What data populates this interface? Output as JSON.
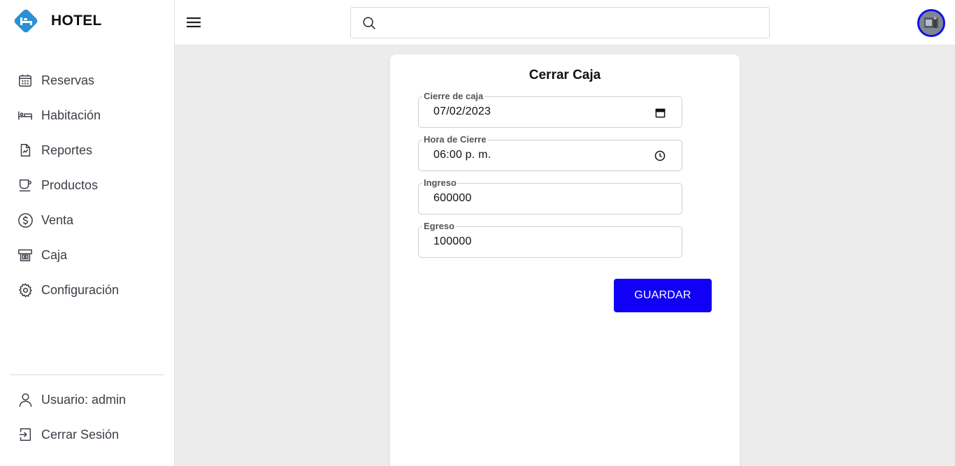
{
  "brand": {
    "title": "HOTEL",
    "logo_icon": "hotel-bed-logo",
    "logo_color": "#2a8fd6"
  },
  "sidebar": {
    "items": [
      {
        "label": "Reservas",
        "icon": "calendar-icon"
      },
      {
        "label": "Habitación",
        "icon": "bed-icon"
      },
      {
        "label": "Reportes",
        "icon": "report-icon"
      },
      {
        "label": "Productos",
        "icon": "cup-icon"
      },
      {
        "label": "Venta",
        "icon": "dollar-circle-icon"
      },
      {
        "label": "Caja",
        "icon": "cash-register-icon"
      },
      {
        "label": "Configuración",
        "icon": "gear-icon"
      }
    ],
    "footer": [
      {
        "label": "Usuario: admin",
        "icon": "user-icon"
      },
      {
        "label": "Cerrar Sesión",
        "icon": "logout-icon"
      }
    ]
  },
  "header": {
    "menu_icon": "hamburger-menu-icon",
    "search": {
      "placeholder": "",
      "value": ""
    },
    "avatar_border_color": "#1212e6"
  },
  "form": {
    "title": "Cerrar Caja",
    "fields": [
      {
        "legend": "Cierre de caja",
        "value": "07/02/2023",
        "icon": "calendar-picker-icon"
      },
      {
        "legend": "Hora de Cierre",
        "value": "06:00 p. m.",
        "icon": "clock-icon"
      },
      {
        "legend": "Ingreso",
        "value": "600000"
      },
      {
        "legend": "Egreso",
        "value": "100000"
      }
    ],
    "save_label": "GUARDAR",
    "save_color": "#1000f5"
  }
}
